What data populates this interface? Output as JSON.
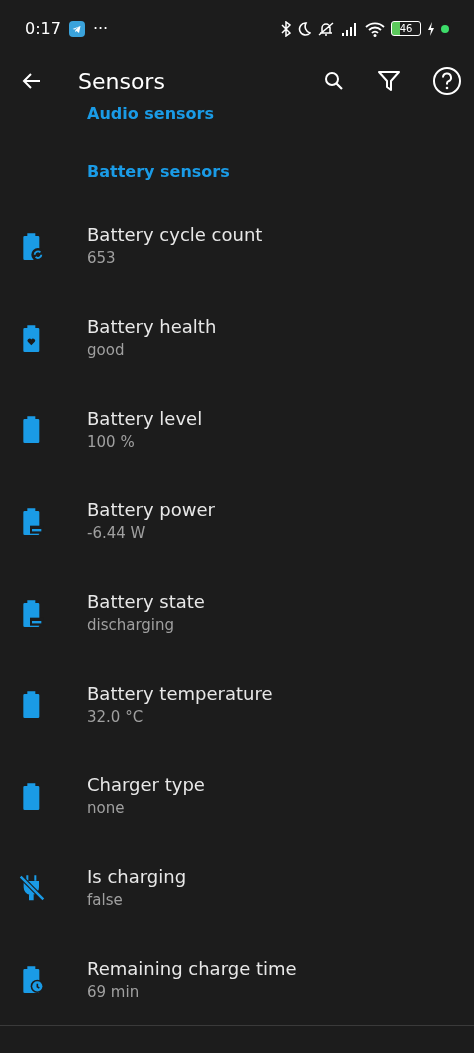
{
  "status_bar": {
    "time": "0:17",
    "more": "···",
    "battery": "46"
  },
  "toolbar": {
    "title": "Sensors"
  },
  "sections": [
    {
      "header": "Audio sensors"
    },
    {
      "header": "Battery sensors",
      "items": [
        {
          "kind": "battery-sync",
          "name": "Battery cycle count",
          "value": "653"
        },
        {
          "kind": "battery-heart",
          "name": "Battery health",
          "value": "good"
        },
        {
          "kind": "battery",
          "name": "Battery level",
          "value": "100 %"
        },
        {
          "kind": "battery-minus",
          "name": "Battery power",
          "value": "-6.44 W"
        },
        {
          "kind": "battery-minus",
          "name": "Battery state",
          "value": "discharging"
        },
        {
          "kind": "battery",
          "name": "Battery temperature",
          "value": "32.0 °C"
        },
        {
          "kind": "battery",
          "name": "Charger type",
          "value": "none"
        },
        {
          "kind": "plug-off",
          "name": "Is charging",
          "value": "false"
        },
        {
          "kind": "battery-clock",
          "name": "Remaining charge time",
          "value": "69 min"
        }
      ]
    }
  ]
}
